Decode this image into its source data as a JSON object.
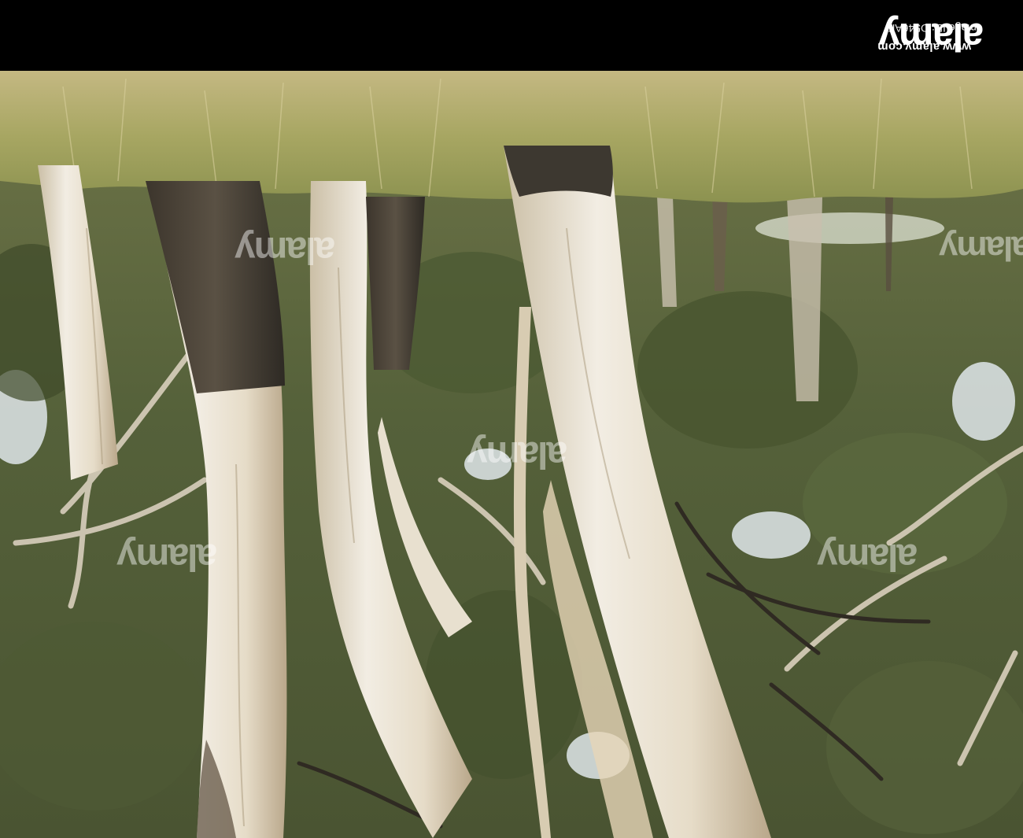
{
  "footer": {
    "site_url": "www.alamy.com",
    "image_id": "Image ID: D546AK",
    "logo_text": "alamy"
  },
  "watermark_text": "alamy",
  "scene": {
    "orientation": "upside-down",
    "subject": "eucalyptus-trunks",
    "colors": {
      "sky": "#dfe8ee",
      "foliage": "#5e6a3c",
      "foliage_dark": "#3a4428",
      "grass": "#b9ad74",
      "grass_green": "#8a9648",
      "bark_pale": "#eae3d4",
      "bark_dark": "#4a4338"
    }
  }
}
